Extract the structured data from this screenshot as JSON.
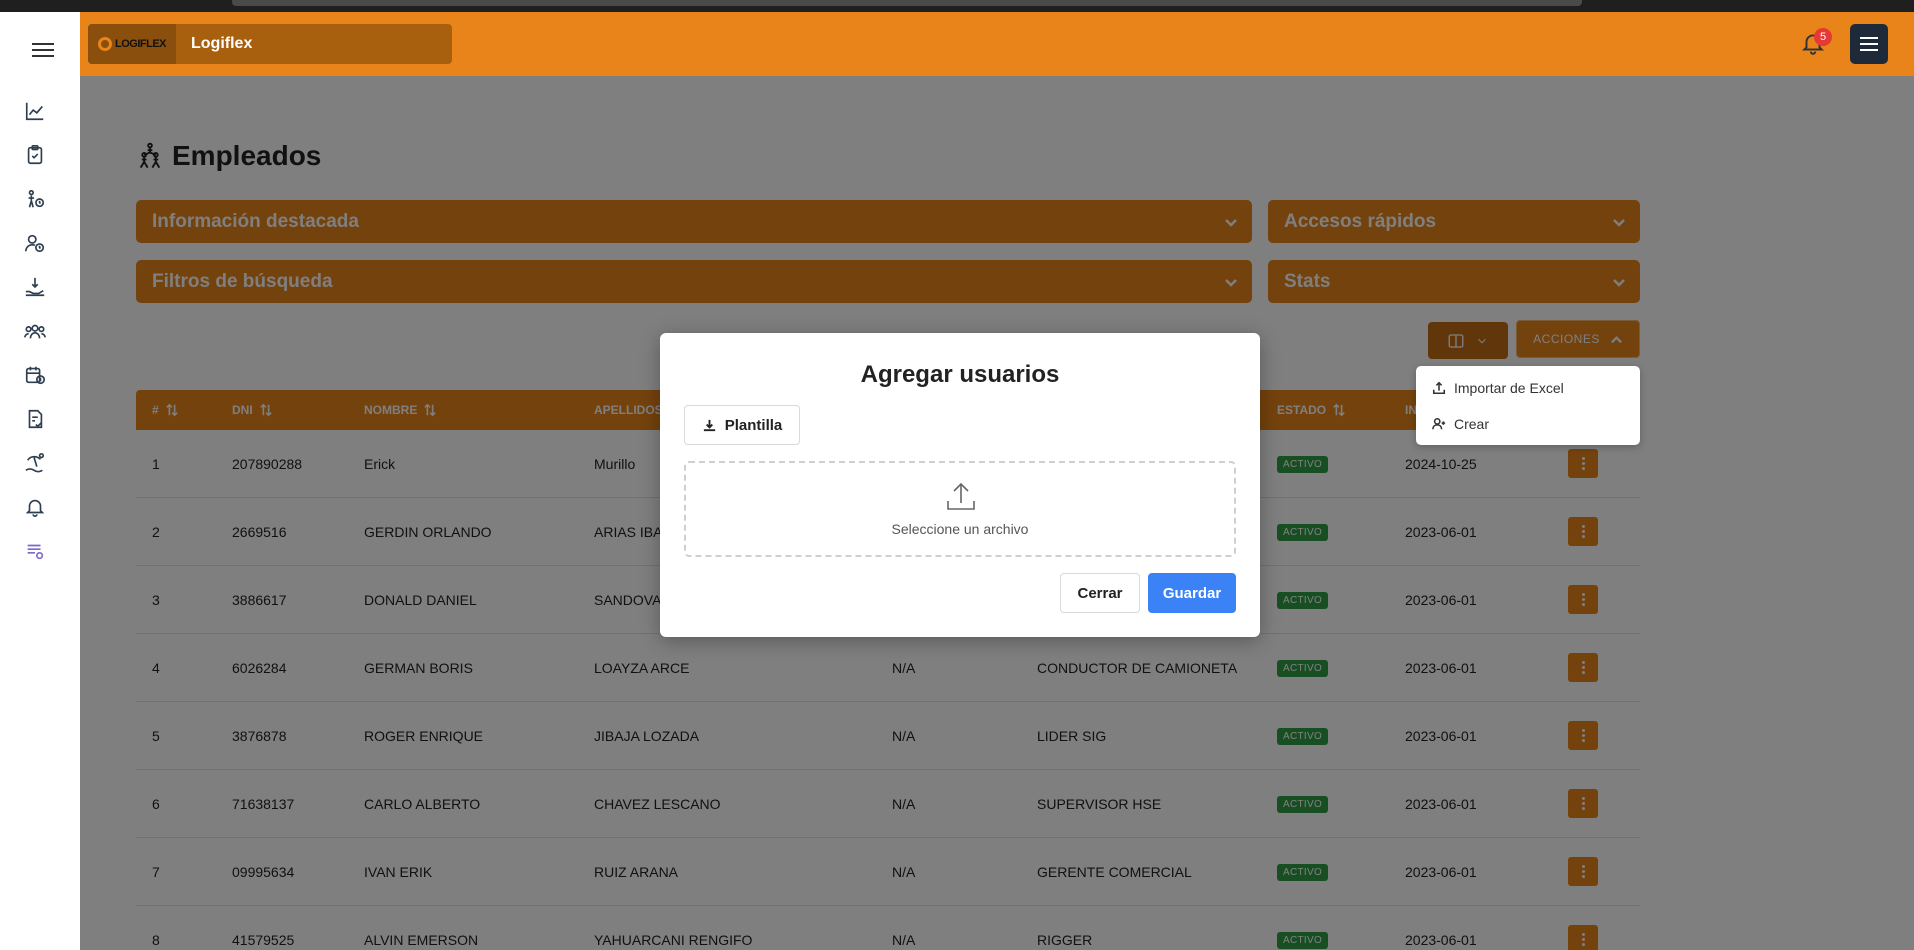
{
  "app": {
    "name": "Logiflex",
    "logo_text": "LOGIFLEX",
    "notification_count": "5"
  },
  "page": {
    "title": "Empleados"
  },
  "panels": {
    "highlight": "Información destacada",
    "quick_access": "Accesos rápidos",
    "filters": "Filtros de búsqueda",
    "stats": "Stats"
  },
  "toolbar": {
    "actions_label": "ACCIONES"
  },
  "table": {
    "headers": {
      "num": "#",
      "dni": "DNI",
      "nombre": "NOMBRE",
      "apellidos": "APELLIDOS",
      "estado": "ESTADO",
      "ingreso": "IN"
    },
    "rows": [
      {
        "num": "1",
        "dni": "207890288",
        "nombre": "Erick",
        "apellidos": "Murillo",
        "col5": "",
        "cargo": "",
        "estado": "ACTIVO",
        "fecha": "2024-10-25"
      },
      {
        "num": "2",
        "dni": "2669516",
        "nombre": "GERDIN ORLANDO",
        "apellidos": "ARIAS IBAÑEZ",
        "col5": "",
        "cargo": "",
        "estado": "ACTIVO",
        "fecha": "2023-06-01"
      },
      {
        "num": "3",
        "dni": "3886617",
        "nombre": "DONALD DANIEL",
        "apellidos": "SANDOVAL",
        "col5": "",
        "cargo": "",
        "estado": "ACTIVO",
        "fecha": "2023-06-01"
      },
      {
        "num": "4",
        "dni": "6026284",
        "nombre": "GERMAN BORIS",
        "apellidos": "LOAYZA ARCE",
        "col5": "N/A",
        "cargo": "CONDUCTOR DE CAMIONETA",
        "estado": "ACTIVO",
        "fecha": "2023-06-01"
      },
      {
        "num": "5",
        "dni": "3876878",
        "nombre": "ROGER ENRIQUE",
        "apellidos": "JIBAJA LOZADA",
        "col5": "N/A",
        "cargo": "LIDER SIG",
        "estado": "ACTIVO",
        "fecha": "2023-06-01"
      },
      {
        "num": "6",
        "dni": "71638137",
        "nombre": "CARLO ALBERTO",
        "apellidos": "CHAVEZ LESCANO",
        "col5": "N/A",
        "cargo": "SUPERVISOR HSE",
        "estado": "ACTIVO",
        "fecha": "2023-06-01"
      },
      {
        "num": "7",
        "dni": "09995634",
        "nombre": "IVAN ERIK",
        "apellidos": "RUIZ ARANA",
        "col5": "N/A",
        "cargo": "GERENTE COMERCIAL",
        "estado": "ACTIVO",
        "fecha": "2023-06-01"
      },
      {
        "num": "8",
        "dni": "41579525",
        "nombre": "ALVIN EMERSON",
        "apellidos": "YAHUARCANI RENGIFO",
        "col5": "N/A",
        "cargo": "RIGGER",
        "estado": "ACTIVO",
        "fecha": "2023-06-01"
      }
    ]
  },
  "dropdown": {
    "import_label": "Importar de Excel",
    "create_label": "Crear"
  },
  "modal": {
    "title": "Agregar usuarios",
    "template_label": "Plantilla",
    "dropzone_text": "Seleccione un archivo",
    "close_label": "Cerrar",
    "save_label": "Guardar"
  },
  "colors": {
    "accent": "#e8841a",
    "primary": "#3b82f6",
    "success": "#2e9e45",
    "badge": "#e53935"
  },
  "icons": {
    "sidebar": [
      "chart-line-icon",
      "clipboard-icon",
      "person-clock-icon",
      "user-clock-icon",
      "hand-money-icon",
      "users-icon",
      "calendar-money-icon",
      "document-check-icon",
      "beach-icon",
      "bell-icon",
      "list-settings-icon"
    ]
  }
}
